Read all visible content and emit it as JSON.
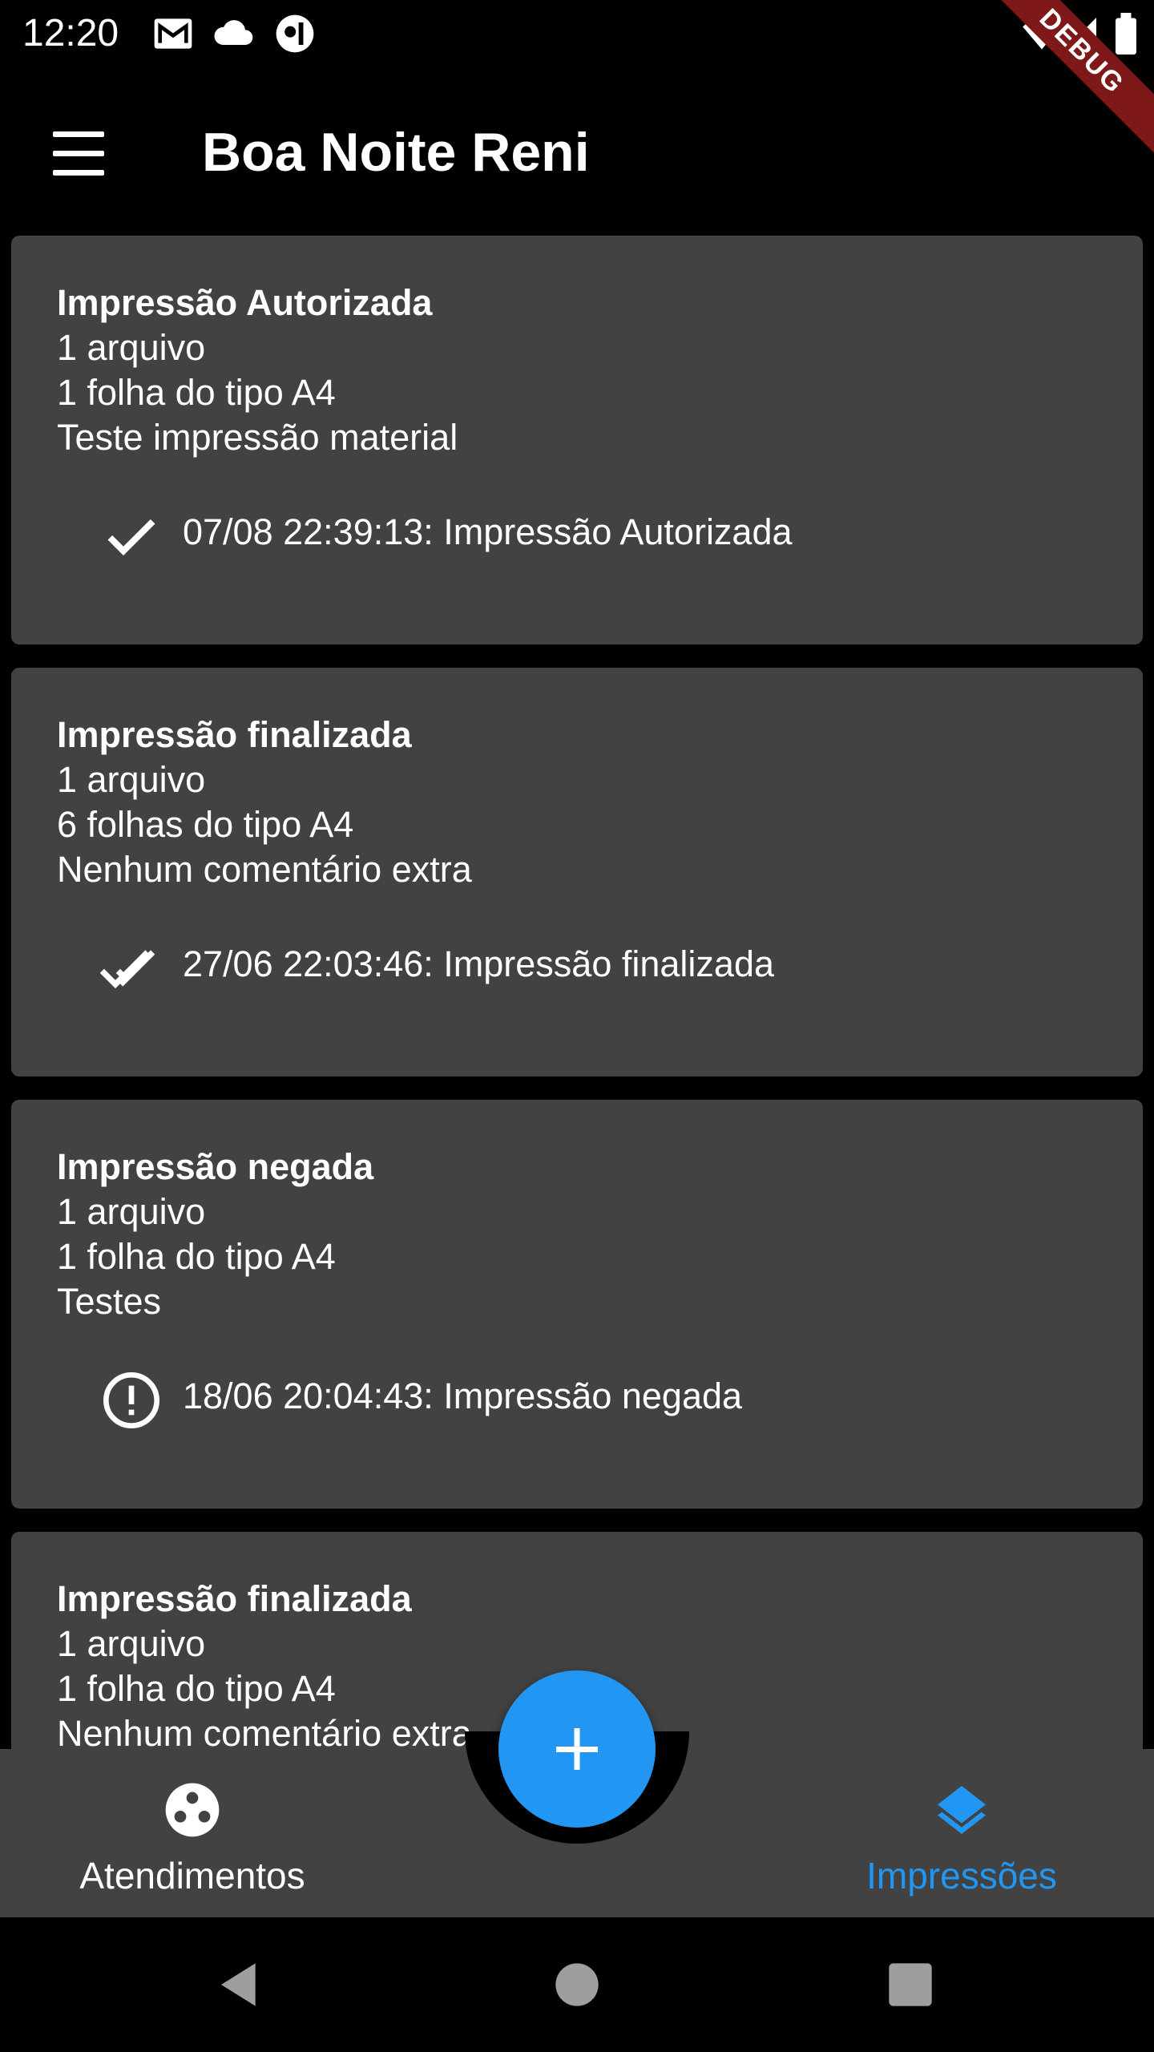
{
  "status_bar": {
    "time": "12:20",
    "icons": [
      "gmail-icon",
      "cloud-icon",
      "notification-icon",
      "wifi-icon",
      "signal-icon",
      "battery-icon"
    ],
    "debug_label": "DEBUG"
  },
  "app_bar": {
    "title": "Boa Noite Reni"
  },
  "cards": [
    {
      "title": "Impressão Autorizada",
      "files": "1 arquivo",
      "sheets": "1 folha do tipo A4",
      "comment": "Teste impressão material",
      "status_icon": "check-icon",
      "status_text": "07/08 22:39:13: Impressão Autorizada"
    },
    {
      "title": "Impressão finalizada",
      "files": "1 arquivo",
      "sheets": "6 folhas do tipo A4",
      "comment": "Nenhum comentário extra",
      "status_icon": "double-check-icon",
      "status_text": "27/06 22:03:46: Impressão finalizada"
    },
    {
      "title": "Impressão negada",
      "files": "1 arquivo",
      "sheets": "1 folha do tipo A4",
      "comment": "Testes",
      "status_icon": "alert-circle-icon",
      "status_text": "18/06 20:04:43: Impressão negada"
    },
    {
      "title": "Impressão finalizada",
      "files": "1 arquivo",
      "sheets": "1 folha do tipo A4",
      "comment": "Nenhum comentário extra",
      "status_icon": "double-check-icon",
      "status_text": ""
    }
  ],
  "bottom_nav": {
    "items": [
      {
        "label": "Atendimentos",
        "icon": "bubbles-icon",
        "active": false
      },
      {
        "label": "Impressões",
        "icon": "layers-icon",
        "active": true
      }
    ],
    "fab_icon": "plus-icon",
    "active_color": "#2196f3"
  },
  "colors": {
    "background": "#000000",
    "card": "#424242",
    "accent": "#2196f3",
    "debug_banner": "#7f1818"
  }
}
